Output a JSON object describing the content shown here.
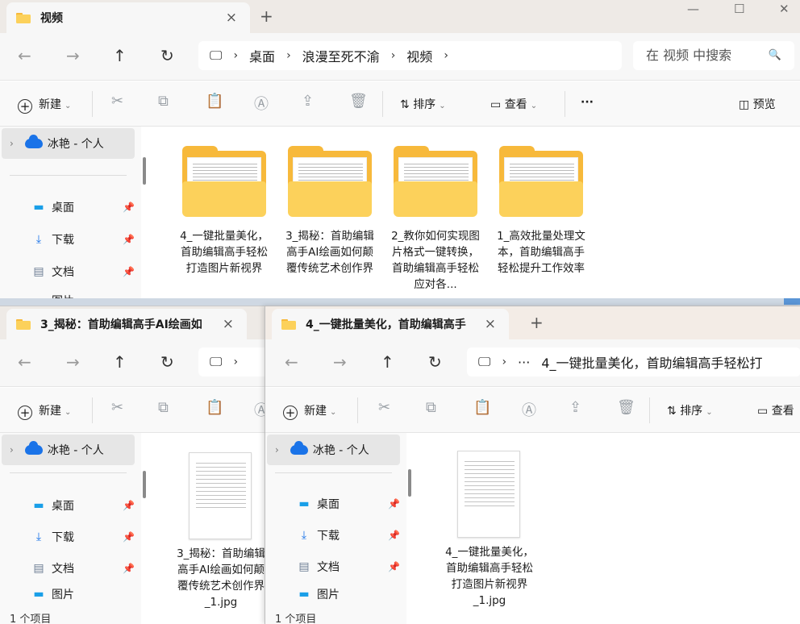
{
  "common": {
    "new_label": "新建",
    "sort_label": "排序",
    "view_label": "查看",
    "more_label": "···",
    "preview_label": "预览",
    "new_tab_glyph": "+",
    "close_glyph": "×",
    "cloud_label": "冰艳 - 个人",
    "sidebar_items": [
      {
        "label": "桌面",
        "icon": "desktop-icon"
      },
      {
        "label": "下载",
        "icon": "download-icon"
      },
      {
        "label": "文档",
        "icon": "document-icon"
      },
      {
        "label": "图片",
        "icon": "pictures-icon"
      }
    ],
    "status_text": "1 个项目"
  },
  "window1": {
    "tab_title": "视频",
    "breadcrumb": [
      "桌面",
      "浪漫至死不渝",
      "视频"
    ],
    "search_placeholder": "在 视频 中搜索",
    "folders": [
      {
        "name": "4_一键批量美化，首助编辑高手轻松打造图片新视界"
      },
      {
        "name": "3_揭秘：首助编辑高手AI绘画如何颠覆传统艺术创作界"
      },
      {
        "name": "2_教你如何实现图片格式一键转换，首助编辑高手轻松应对各..."
      },
      {
        "name": "1_高效批量处理文本，首助编辑高手轻松提升工作效率"
      }
    ]
  },
  "window2": {
    "tab_title": "3_揭秘：首助编辑高手AI绘画如",
    "file_name": "3_揭秘：首助编辑高手AI绘画如何颠覆传统艺术创作界_1.jpg"
  },
  "window3": {
    "tab_title": "4_一键批量美化，首助编辑高手",
    "address_ellipsis": "···",
    "address_text": "4_一键批量美化，首助编辑高手轻松打",
    "file_name": "4_一键批量美化，首助编辑高手轻松打造图片新视界_1.jpg"
  },
  "colors": {
    "folder": "#f7b93b",
    "accent": "#1a73e8"
  }
}
